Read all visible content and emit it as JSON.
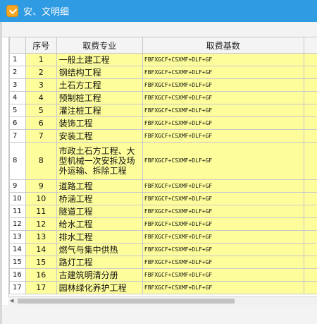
{
  "window": {
    "title": "安、文明细",
    "icon": "app-logo-icon"
  },
  "table": {
    "headers": {
      "rownum": "",
      "seq": "序号",
      "major": "取费专业",
      "basis": "取费基数"
    },
    "rows": [
      {
        "rownum": "1",
        "seq": "1",
        "major": "一般土建工程",
        "basis": "FBFXGCF+CSXMF+DLF+GF"
      },
      {
        "rownum": "2",
        "seq": "2",
        "major": "钢结构工程",
        "basis": "FBFXGCF+CSXMF+DLF+GF"
      },
      {
        "rownum": "3",
        "seq": "3",
        "major": "土石方工程",
        "basis": "FBFXGCF+CSXMF+DLF+GF"
      },
      {
        "rownum": "4",
        "seq": "4",
        "major": "预制桩工程",
        "basis": "FBFXGCF+CSXMF+DLF+GF"
      },
      {
        "rownum": "5",
        "seq": "5",
        "major": "灌注桩工程",
        "basis": "FBFXGCF+CSXMF+DLF+GF"
      },
      {
        "rownum": "6",
        "seq": "6",
        "major": "装饰工程",
        "basis": "FBFXGCF+CSXMF+DLF+GF"
      },
      {
        "rownum": "7",
        "seq": "7",
        "major": "安装工程",
        "basis": "FBFXGCF+CSXMF+DLF+GF"
      },
      {
        "rownum": "8",
        "seq": "8",
        "major": "市政土石方工程、大型机械一次安拆及场外运输、拆除工程",
        "basis": "FBFXGCF+CSXMF+DLF+GF"
      },
      {
        "rownum": "9",
        "seq": "9",
        "major": "道路工程",
        "basis": "FBFXGCF+CSXMF+DLF+GF"
      },
      {
        "rownum": "10",
        "seq": "10",
        "major": "桥涵工程",
        "basis": "FBFXGCF+CSXMF+DLF+GF"
      },
      {
        "rownum": "11",
        "seq": "11",
        "major": "隧道工程",
        "basis": "FBFXGCF+CSXMF+DLF+GF"
      },
      {
        "rownum": "12",
        "seq": "12",
        "major": "给水工程",
        "basis": "FBFXGCF+CSXMF+DLF+GF"
      },
      {
        "rownum": "13",
        "seq": "13",
        "major": "排水工程",
        "basis": "FBFXGCF+CSXMF+DLF+GF"
      },
      {
        "rownum": "14",
        "seq": "14",
        "major": "燃气与集中供热",
        "basis": "FBFXGCF+CSXMF+DLF+GF"
      },
      {
        "rownum": "15",
        "seq": "15",
        "major": "路灯工程",
        "basis": "FBFXGCF+CSXMF+DLF+GF"
      },
      {
        "rownum": "16",
        "seq": "16",
        "major": "古建筑明清分册",
        "basis": "FBFXGCF+CSXMF+DLF+GF"
      },
      {
        "rownum": "17",
        "seq": "17",
        "major": "园林绿化养护工程",
        "basis": "FBFXGCF+CSXMF+DLF+GF"
      }
    ]
  },
  "scrollbar": {
    "left_arrow": "◀"
  }
}
